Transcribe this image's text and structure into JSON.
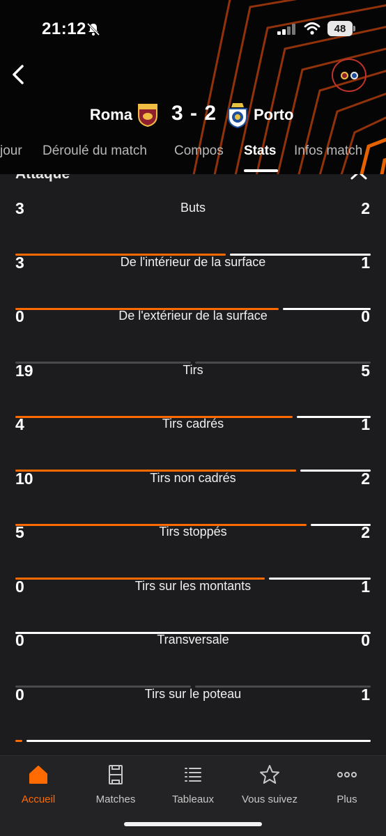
{
  "status_bar": {
    "time": "21:12",
    "battery": "48"
  },
  "colors": {
    "accent": "#ff6b00",
    "away_bar": "#ffffff",
    "neutral_bar": "#4a4a4c",
    "background": "#1c1c1e",
    "header_bg": "#050505"
  },
  "match": {
    "home_team": "Roma",
    "away_team": "Porto",
    "score": "3 - 2"
  },
  "tabs": [
    {
      "label": "jour"
    },
    {
      "label": "Déroulé du match"
    },
    {
      "label": "Compos"
    },
    {
      "label": "Stats",
      "active": true
    },
    {
      "label": "Infos match"
    }
  ],
  "section": {
    "title": "Attaque"
  },
  "stats": [
    {
      "label": "Buts",
      "home": "3",
      "away": "2",
      "home_share": 0.6
    },
    {
      "label": "De l'intérieur de la surface",
      "home": "3",
      "away": "1",
      "home_share": 0.75
    },
    {
      "label": "De l'extérieur de la surface",
      "home": "0",
      "away": "0",
      "home_share": null
    },
    {
      "label": "Tirs",
      "home": "19",
      "away": "5",
      "home_share": 0.79
    },
    {
      "label": "Tirs cadrés",
      "home": "4",
      "away": "1",
      "home_share": 0.8
    },
    {
      "label": "Tirs non cadrés",
      "home": "10",
      "away": "2",
      "home_share": 0.83
    },
    {
      "label": "Tirs stoppés",
      "home": "5",
      "away": "2",
      "home_share": 0.71
    },
    {
      "label": "Tirs sur les montants",
      "home": "0",
      "away": "1",
      "home_share": 0.0
    },
    {
      "label": "Transversale",
      "home": "0",
      "away": "0",
      "home_share": null
    },
    {
      "label": "Tirs sur le poteau",
      "home": "0",
      "away": "1",
      "home_share": 0.0
    }
  ],
  "nav": [
    {
      "label": "Accueil",
      "icon": "home-icon",
      "active": true
    },
    {
      "label": "Matches",
      "icon": "pitch-icon"
    },
    {
      "label": "Tableaux",
      "icon": "list-icon"
    },
    {
      "label": "Vous suivez",
      "icon": "star-icon"
    },
    {
      "label": "Plus",
      "icon": "more-icon"
    }
  ]
}
